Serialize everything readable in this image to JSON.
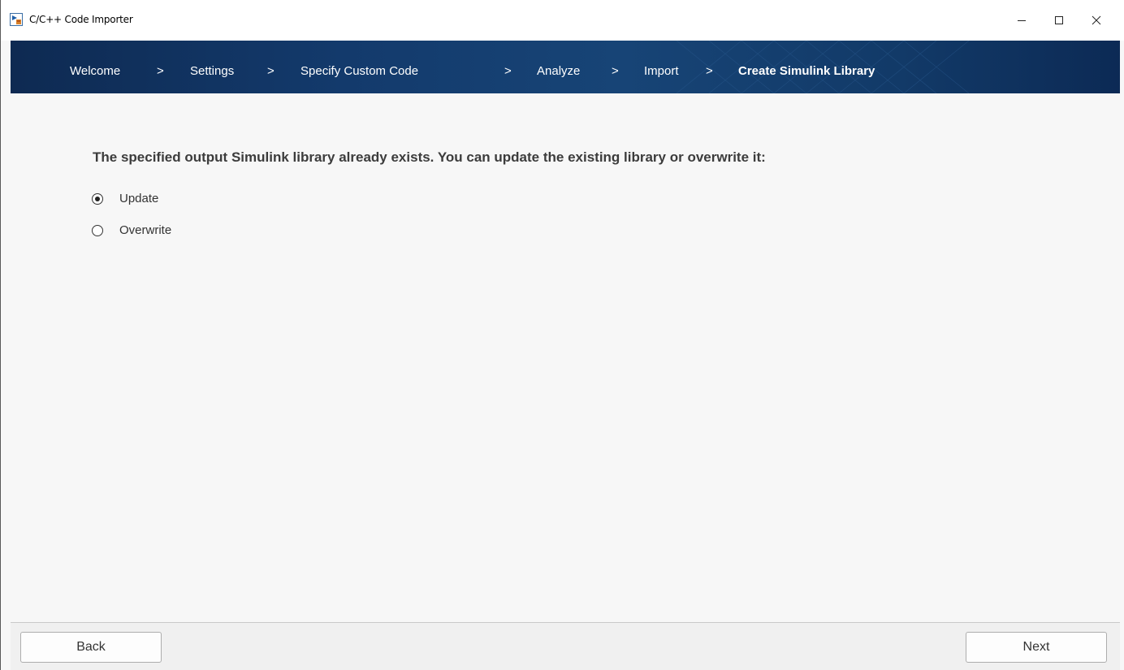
{
  "window": {
    "title": "C/C++ Code Importer",
    "controls": {
      "minimize": "–",
      "maximize": "□",
      "close": "✕"
    }
  },
  "breadcrumb": {
    "steps": [
      {
        "label": "Welcome",
        "active": false
      },
      {
        "label": "Settings",
        "active": false
      },
      {
        "label": "Specify Custom Code",
        "active": false
      },
      {
        "label": "Analyze",
        "active": false
      },
      {
        "label": "Import",
        "active": false
      },
      {
        "label": "Create Simulink Library",
        "active": true
      }
    ],
    "separator": ">"
  },
  "main": {
    "question": "The specified output Simulink library already exists. You can update the existing library or overwrite it:",
    "options": [
      {
        "label": "Update",
        "selected": true
      },
      {
        "label": "Overwrite",
        "selected": false
      }
    ]
  },
  "footer": {
    "back_label": "Back",
    "next_label": "Next"
  },
  "colors": {
    "banner": "#174476",
    "background": "#f7f7f7",
    "text": "#3c3c3c"
  }
}
